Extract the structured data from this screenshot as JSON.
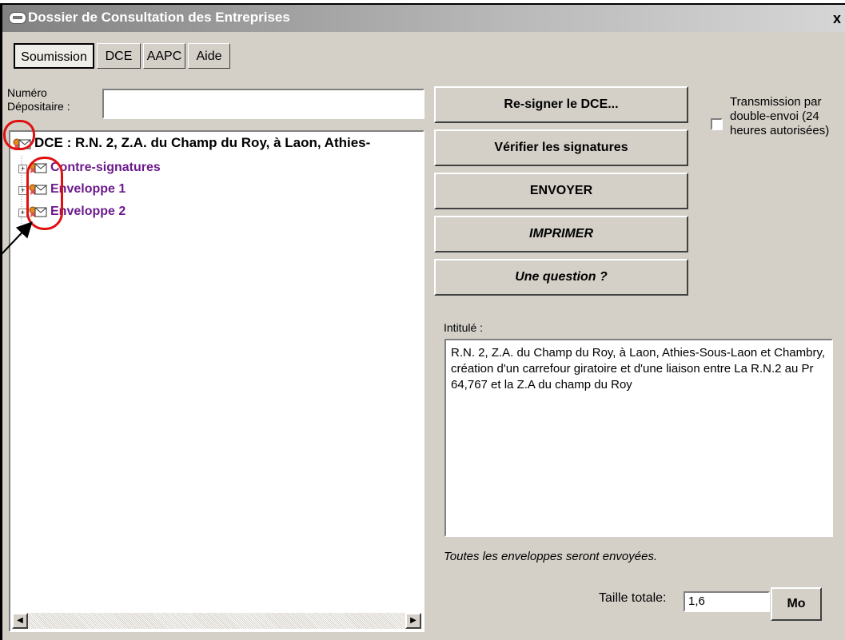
{
  "window": {
    "title": "Dossier de Consultation des Entreprises",
    "close": "x"
  },
  "tabs": [
    {
      "label": "Soumission"
    },
    {
      "label": "DCE"
    },
    {
      "label": "AAPC"
    },
    {
      "label": "Aide"
    }
  ],
  "depositaire": {
    "label_line1": "Numéro",
    "label_line2": "Dépositaire :",
    "value": ""
  },
  "tree": {
    "root": "DCE : R.N. 2, Z.A. du Champ du Roy, à Laon, Athies-",
    "nodes": [
      {
        "label": "Contre-signatures"
      },
      {
        "label": "Enveloppe 1"
      },
      {
        "label": "Enveloppe 2"
      }
    ]
  },
  "buttons": {
    "resign": "Re-signer le DCE...",
    "verify": "Vérifier les signatures",
    "send": "ENVOYER",
    "print": "IMPRIMER",
    "question": "Une question ?",
    "unit": "Mo"
  },
  "transmission": {
    "line1": "Transmission par",
    "line2": "double-envoi (24",
    "line3": "heures autorisées)"
  },
  "intitule": {
    "label": "Intitulé :",
    "text": "R.N. 2, Z.A. du Champ du Roy, à Laon, Athies-Sous-Laon et Chambry, création d'un carrefour giratoire et d'une liaison entre La R.N.2 au Pr 64,767 et la Z.A du champ du Roy"
  },
  "notice": "Toutes les enveloppes seront envoyées.",
  "size": {
    "label": "Taille totale:",
    "value": "1,6"
  },
  "colors": {
    "annotation": "#e01010",
    "node_text": "#6b1b8c"
  }
}
